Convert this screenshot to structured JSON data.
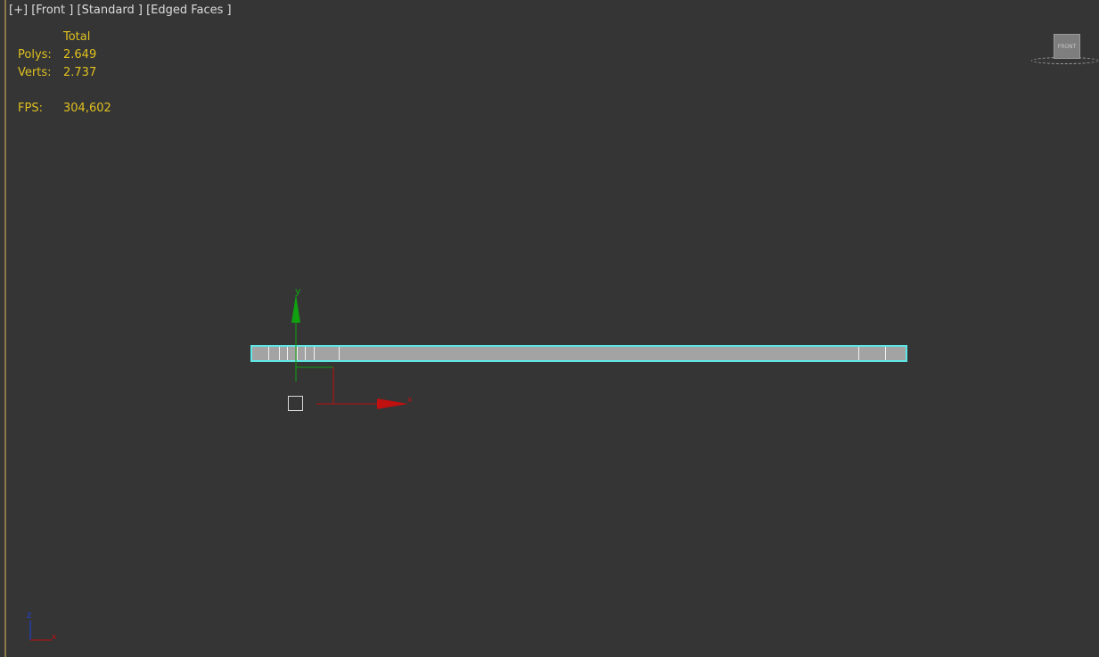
{
  "viewport": {
    "labels": {
      "plus": "[+]",
      "view": "[Front ]",
      "shading": "[Standard ]",
      "mode": "[Edged Faces ]"
    },
    "stats": {
      "header": "Total",
      "polys_label": "Polys:",
      "polys_value": "2.649",
      "verts_label": "Verts:",
      "verts_value": "2.737",
      "fps_label": "FPS:",
      "fps_value": "304,602"
    },
    "viewcube": {
      "face_label": "FRONT"
    },
    "gizmo": {
      "y_label": "y",
      "x_label": "x"
    },
    "corner_axis": {
      "z_label": "z",
      "x_label": "x"
    }
  },
  "colors": {
    "background": "#353535",
    "stats_text": "#e0c020",
    "selection": "#5fe6e6",
    "axis_x": "#c01010",
    "axis_y": "#10a010",
    "axis_z": "#2040e0"
  }
}
